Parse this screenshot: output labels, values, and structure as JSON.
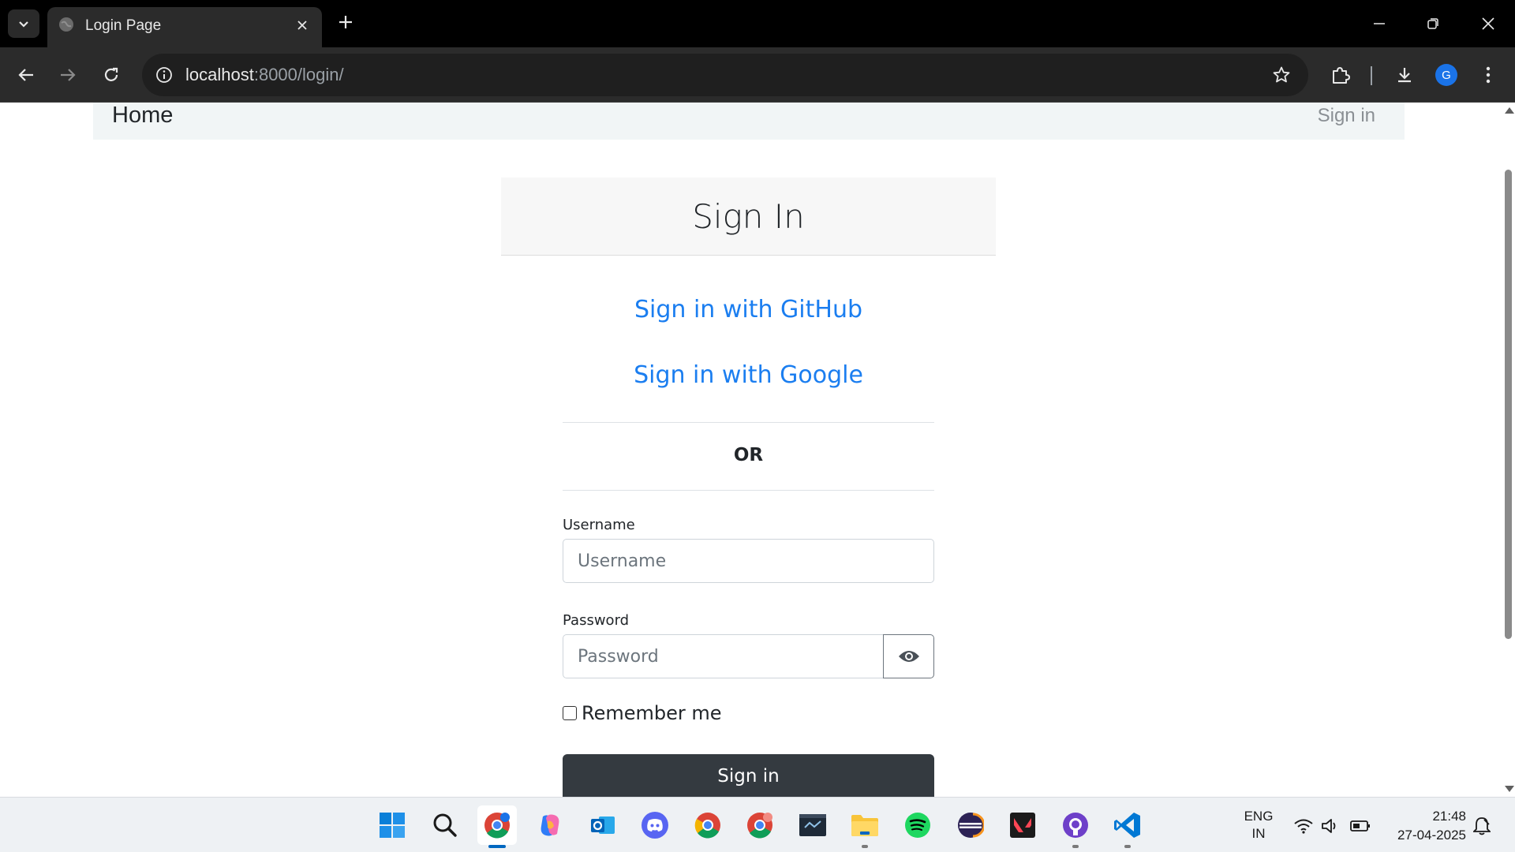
{
  "browser": {
    "tab": {
      "title": "Login Page"
    },
    "address": {
      "host": "localhost",
      "rest": ":8000/login/"
    },
    "profile_initial": "G"
  },
  "site_nav": {
    "brand": "Home",
    "signin_link": "Sign in"
  },
  "login": {
    "title": "Sign In",
    "github_link": "Sign in with GitHub",
    "google_link": "Sign in with Google",
    "or_text": "OR",
    "username_label": "Username",
    "username_placeholder": "Username",
    "password_label": "Password",
    "password_placeholder": "Password",
    "remember_label": "Remember me",
    "submit_label": "Sign in"
  },
  "taskbar": {
    "apps": [
      "windows-start",
      "search",
      "chrome-profile-g",
      "copilot",
      "outlook",
      "discord",
      "chrome",
      "chrome-profile-2",
      "mysql-workbench",
      "file-explorer",
      "spotify",
      "eclipse",
      "valorant",
      "github-desktop",
      "vscode"
    ],
    "language": {
      "line1": "ENG",
      "line2": "IN"
    },
    "time": "21:48",
    "date": "27-04-2025"
  },
  "colors": {
    "link": "#1b7ef0",
    "button_dark": "#343a40",
    "nav_bg": "#f1f5f6"
  }
}
